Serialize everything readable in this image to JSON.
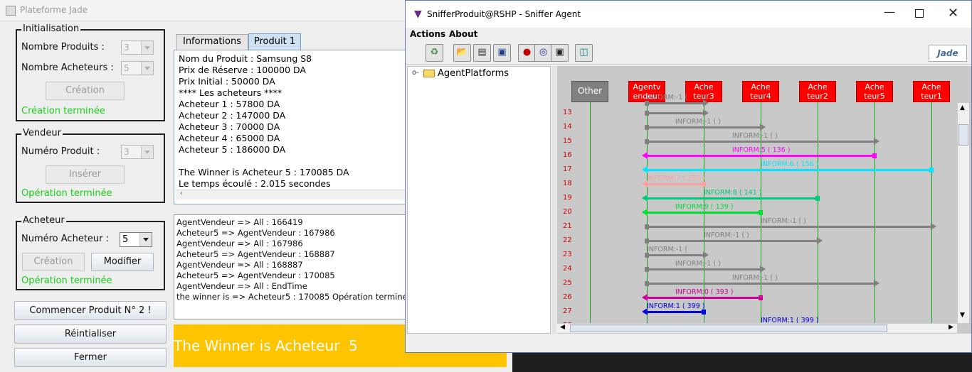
{
  "jade": {
    "title": "Plateforme Jade",
    "init": {
      "legend": "Initialisation",
      "nb_produits_label": "Nombre Produits :",
      "nb_produits_value": "3",
      "nb_acheteurs_label": "Nombre Acheteurs :",
      "nb_acheteurs_value": "5",
      "creation_button": "Création",
      "status": "Création terminée"
    },
    "vendeur": {
      "legend": "Vendeur",
      "numero_label": "Numéro Produit :",
      "numero_value": "3",
      "inserer_button": "Insérer",
      "status": "Opération terminée"
    },
    "acheteur": {
      "legend": "Acheteur",
      "numero_label": "Numéro Acheteur :",
      "numero_value": "5",
      "creation_button": "Création",
      "modifier_button": "Modifier",
      "status": "Opération terminée"
    },
    "buttons": {
      "commencer": "Commencer Produit N° 2 !",
      "reinitialiser": "Réintialiser",
      "fermer": "Fermer"
    },
    "tabs": [
      "Informations",
      "Produit 1"
    ],
    "info_lines": [
      "Nom du Produit : Samsung S8",
      "Prix de Réserve : 100000 DA",
      "Prix Initial : 50000 DA",
      "**** Les acheteurs ****",
      "Acheteur 1 : 57800 DA",
      "Acheteur 2 : 147000 DA",
      "Acheteur 3 : 70000 DA",
      "Acheteur 4 : 65000 DA",
      "Acheteur 5 : 186000 DA",
      "",
      "The Winner is Acheteur 5 : 170085 DA",
      "Le temps écoulé : 2.015 secondes"
    ],
    "log_lines": [
      "AgentVendeur => All : 166419",
      "Acheteur5 => AgentVendeur : 167986",
      "AgentVendeur => All : 167986",
      "Acheteur5 => AgentVendeur : 168887",
      "AgentVendeur => All : 168887",
      "Acheteur5 => AgentVendeur : 170085",
      "AgentVendeur => All : EndTime",
      "the winner is => Acheteur5 : 170085 Opération terminée"
    ],
    "winner_banner": "The Winner is Acheteur  5",
    "winner_color": "#ffc400"
  },
  "sniffer": {
    "title": "SnifferProduit@RSHP - Sniffer Agent",
    "menu": [
      "Actions",
      "About"
    ],
    "toolbar_icons": [
      "clear-canvas-icon",
      "open-file-icon",
      "save-as-icon",
      "save-icon",
      "record-icon",
      "sniff-icon",
      "filter-icon",
      "exit-icon"
    ],
    "logo": "Jade",
    "tree_root": "AgentPlatforms",
    "agents": [
      {
        "name": "Other",
        "line1": "Other",
        "line2": ""
      },
      {
        "name": "AgentVendeur",
        "line1": "Agentv",
        "line2": "endeur"
      },
      {
        "name": "Acheteur3",
        "line1": "Ache",
        "line2": "teur3"
      },
      {
        "name": "Acheteur4",
        "line1": "Ache",
        "line2": "teur4"
      },
      {
        "name": "Acheteur2",
        "line1": "Ache",
        "line2": "teur2"
      },
      {
        "name": "Acheteur5",
        "line1": "Ache",
        "line2": "teur5"
      },
      {
        "name": "Acheteur1",
        "line1": "Ache",
        "line2": "teur1"
      }
    ],
    "messages": [
      {
        "row": "",
        "from": 1,
        "to": 2,
        "label": "INFORM:-1 (",
        "color": "#808080"
      },
      {
        "row": "13",
        "from": 1,
        "to": 2,
        "label": "",
        "color": "#808080"
      },
      {
        "row": "14",
        "from": 1,
        "to": 3,
        "label": "INFORM:-1 (      )",
        "color": "#808080"
      },
      {
        "row": "15",
        "from": 1,
        "to": 5,
        "label": "INFORM:-1 (      )",
        "color": "#808080"
      },
      {
        "row": "16",
        "from": 5,
        "to": 1,
        "label": "INFORM:5 (   136   )",
        "color": "#ff00ff"
      },
      {
        "row": "17",
        "from": 6,
        "to": 1,
        "label": "INFORM:6 (   156   )",
        "color": "#00e5ff"
      },
      {
        "row": "18",
        "from": 2,
        "to": 1,
        "label": "INFORM:7 (   155   )",
        "color": "#ffa0a0"
      },
      {
        "row": "19",
        "from": 4,
        "to": 1,
        "label": "INFORM:8 (   141   )",
        "color": "#00c87a"
      },
      {
        "row": "20",
        "from": 3,
        "to": 1,
        "label": "INFORM:9 (   139   )",
        "color": "#00dd33"
      },
      {
        "row": "21",
        "from": 1,
        "to": 6,
        "label": "INFORM:-1 (      )",
        "color": "#808080"
      },
      {
        "row": "22",
        "from": 1,
        "to": 4,
        "label": "INFORM:-1 (      )",
        "color": "#808080"
      },
      {
        "row": "23",
        "from": 1,
        "to": 2,
        "label": "INFORM:-1 (",
        "color": "#808080"
      },
      {
        "row": "24",
        "from": 1,
        "to": 3,
        "label": "INFORM:-1 (      )",
        "color": "#808080"
      },
      {
        "row": "25",
        "from": 1,
        "to": 5,
        "label": "INFORM:-1 (      )",
        "color": "#808080"
      },
      {
        "row": "26",
        "from": 3,
        "to": 1,
        "label": "INFORM:0 (   393   )",
        "color": "#cc0099"
      },
      {
        "row": "27",
        "from": 2,
        "to": 1,
        "label": "INFORM:1 (   399   )",
        "color": "#0000dd"
      },
      {
        "row": "28",
        "from": 6,
        "to": 1,
        "label": "INFORM:1 (   399   )",
        "color": "#0000dd"
      }
    ]
  }
}
